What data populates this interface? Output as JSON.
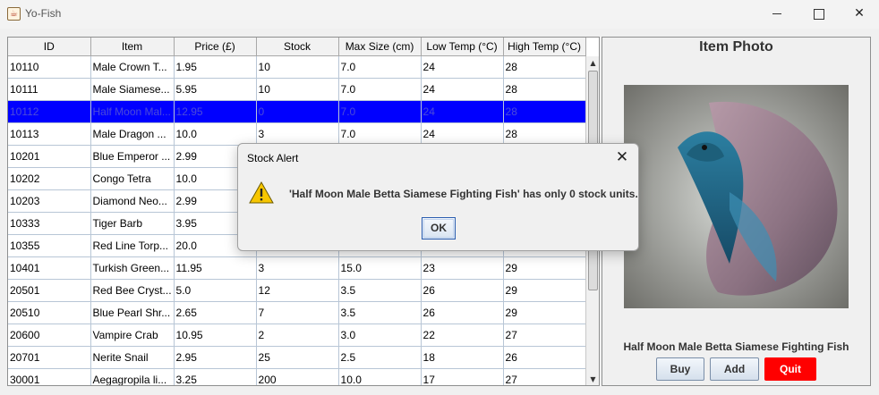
{
  "window": {
    "title": "Yo-Fish",
    "minimize_icon": "minimize-icon",
    "maximize_icon": "maximize-icon",
    "close_glyph": "✕"
  },
  "table": {
    "columns": [
      "ID",
      "Item",
      "Price (£)",
      "Stock",
      "Max Size (cm)",
      "Low Temp (°C)",
      "High Temp (°C)"
    ],
    "selected_row": 2,
    "selection_color": "#0000ff",
    "rows": [
      [
        "10110",
        "Male Crown T...",
        "1.95",
        "10",
        "7.0",
        "24",
        "28"
      ],
      [
        "10111",
        "Male Siamese...",
        "5.95",
        "10",
        "7.0",
        "24",
        "28"
      ],
      [
        "10112",
        "Half Moon Mal...",
        "12.95",
        "0",
        "7.0",
        "24",
        "28"
      ],
      [
        "10113",
        "Male Dragon ...",
        "10.0",
        "3",
        "7.0",
        "24",
        "28"
      ],
      [
        "10201",
        "Blue Emperor ...",
        "2.99",
        "",
        "",
        "",
        ""
      ],
      [
        "10202",
        "Congo Tetra",
        "10.0",
        "",
        "",
        "",
        ""
      ],
      [
        "10203",
        "Diamond Neo...",
        "2.99",
        "",
        "",
        "",
        ""
      ],
      [
        "10333",
        "Tiger Barb",
        "3.95",
        "",
        "",
        "",
        ""
      ],
      [
        "10355",
        "Red Line Torp...",
        "20.0",
        "",
        "",
        "",
        ""
      ],
      [
        "10401",
        "Turkish Green...",
        "11.95",
        "3",
        "15.0",
        "23",
        "29"
      ],
      [
        "20501",
        "Red Bee Cryst...",
        "5.0",
        "12",
        "3.5",
        "26",
        "29"
      ],
      [
        "20510",
        "Blue Pearl Shr...",
        "2.65",
        "7",
        "3.5",
        "26",
        "29"
      ],
      [
        "20600",
        "Vampire Crab",
        "10.95",
        "2",
        "3.0",
        "22",
        "27"
      ],
      [
        "20701",
        "Nerite Snail",
        "2.95",
        "25",
        "2.5",
        "18",
        "26"
      ],
      [
        "30001",
        "Aegagropila li...",
        "3.25",
        "200",
        "10.0",
        "17",
        "27"
      ]
    ]
  },
  "photo_panel": {
    "title": "Item Photo",
    "fish_name": "Half Moon Male Betta Siamese Fighting Fish",
    "buttons": {
      "buy": "Buy",
      "add": "Add",
      "quit": "Quit"
    },
    "quit_color": "#ff0000"
  },
  "dialog": {
    "title": "Stock Alert",
    "close_glyph": "✕",
    "icon": "warning-icon",
    "message": "'Half Moon Male Betta Siamese Fighting Fish' has only 0 stock units.",
    "ok_label": "OK"
  }
}
